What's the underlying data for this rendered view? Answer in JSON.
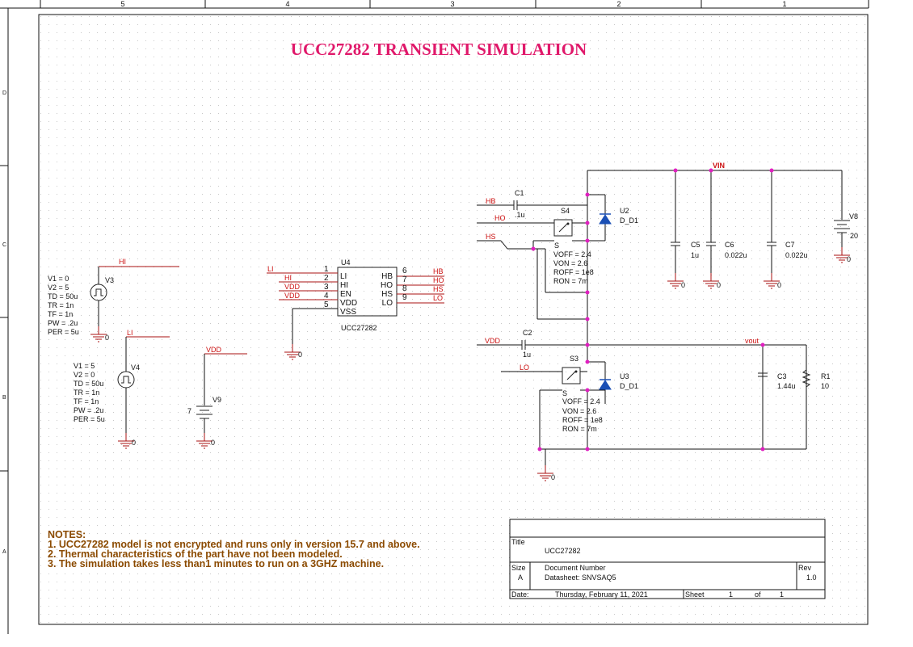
{
  "title": "UCC27282 TRANSIENT SIMULATION",
  "border": {
    "top_zones": [
      "5",
      "4",
      "3",
      "2",
      "1"
    ],
    "side_zones": [
      "D",
      "C",
      "B",
      "A"
    ]
  },
  "sources": {
    "v3": {
      "name": "V3",
      "net": "HI",
      "params": [
        "V1 = 0",
        "V2 = 5",
        "TD = 50u",
        "TR = 1n",
        "TF = 1n",
        "PW = .2u",
        "PER = 5u"
      ]
    },
    "v4": {
      "name": "V4",
      "net": "LI",
      "params": [
        "V1 = 5",
        "V2 = 0",
        "TD = 50u",
        "TR = 1n",
        "TF = 1n",
        "PW = .2u",
        "PER = 5u"
      ]
    },
    "v9": {
      "name": "V9",
      "value": "7",
      "net": "VDD"
    },
    "v8": {
      "name": "V8",
      "value": "20"
    }
  },
  "driver": {
    "ref": "U4",
    "part": "UCC27282",
    "left_pins": [
      {
        "num": "1",
        "name": "LI",
        "net": "LI"
      },
      {
        "num": "2",
        "name": "HI",
        "net": "HI"
      },
      {
        "num": "3",
        "name": "EN",
        "net": "VDD"
      },
      {
        "num": "4",
        "name": "VDD",
        "net": "VDD"
      },
      {
        "num": "5",
        "name": "VSS",
        "net": ""
      }
    ],
    "right_pins": [
      {
        "num": "6",
        "name": "HB",
        "net": "HB"
      },
      {
        "num": "7",
        "name": "HO",
        "net": "HO"
      },
      {
        "num": "8",
        "name": "HS",
        "net": "HS"
      },
      {
        "num": "9",
        "name": "LO",
        "net": "LO"
      }
    ]
  },
  "switches": {
    "s4": {
      "name": "S4",
      "pin": "S",
      "params": [
        "VOFF = 2.4",
        "VON = 2.6",
        "ROFF = 1e8",
        "RON = 7m"
      ]
    },
    "s3": {
      "name": "S3",
      "pin": "S",
      "params": [
        "VOFF = 2.4",
        "VON = 2.6",
        "ROFF = 1e8",
        "RON = 7m"
      ]
    }
  },
  "diodes": {
    "u2": {
      "name": "U2",
      "model": "D_D1"
    },
    "u3": {
      "name": "U3",
      "model": "D_D1"
    }
  },
  "caps": {
    "c1": {
      "name": "C1",
      "value": ".1u"
    },
    "c2": {
      "name": "C2",
      "value": "1u"
    },
    "c3": {
      "name": "C3",
      "value": "1.44u"
    },
    "c5": {
      "name": "C5",
      "value": "1u"
    },
    "c6": {
      "name": "C6",
      "value": "0.022u"
    },
    "c7": {
      "name": "C7",
      "value": "0.022u"
    }
  },
  "resistor": {
    "name": "R1",
    "value": "10"
  },
  "nets": {
    "vin": "VIN",
    "vout": "vout",
    "hb": "HB",
    "ho": "HO",
    "hs": "HS",
    "vdd": "VDD",
    "lo": "LO",
    "gnd": "0"
  },
  "notes": {
    "heading": "NOTES:",
    "lines": [
      "1. UCC27282 model is not encrypted and runs only in version 15.7 and above.",
      "2. Thermal characteristics of the part have not been modeled.",
      "3. The simulation  takes less than1  minutes to run on a 3GHZ machine."
    ]
  },
  "title_block": {
    "title_label": "Title",
    "title_value": "UCC27282",
    "size_label": "Size",
    "size_value": "A",
    "doc_label": "Document Number",
    "doc_value": "Datasheet: SNVSAQ5",
    "rev_label": "Rev",
    "rev_value": "1.0",
    "date_label": "Date:",
    "date_value": "Thursday, February 11, 2021",
    "sheet_label": "Sheet",
    "sheet_num": "1",
    "of_label": "of",
    "sheet_total": "1"
  },
  "colors": {
    "title": "#e0186a",
    "net": "#cc1111",
    "junction": "#e020c0",
    "notes": "#8b4a00",
    "grid": "#cfcfcf"
  }
}
